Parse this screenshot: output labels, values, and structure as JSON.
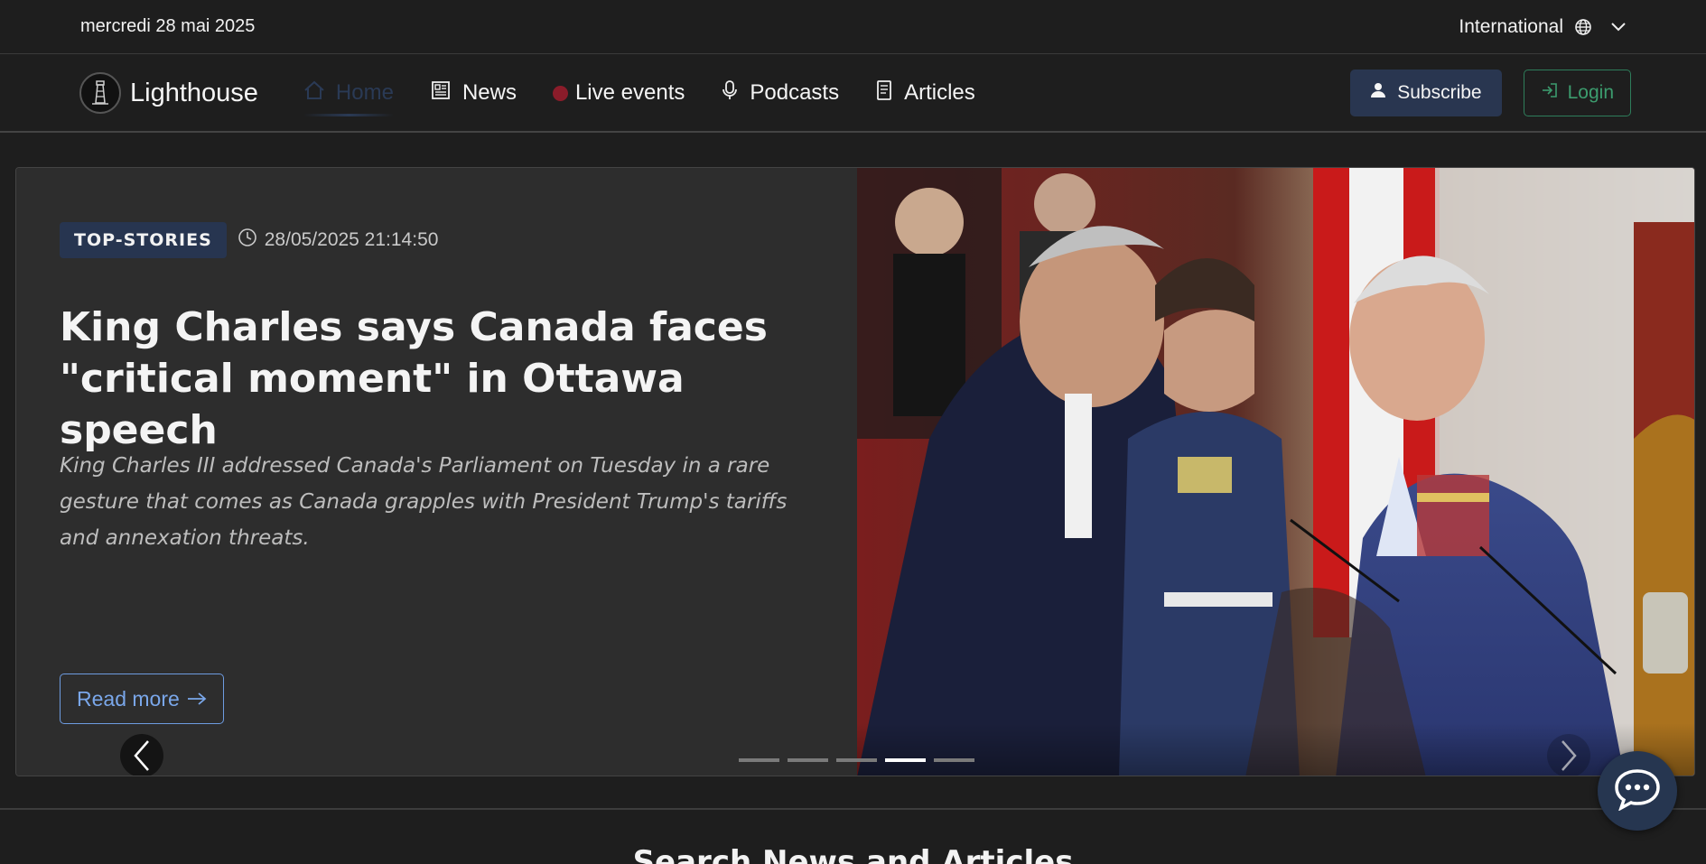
{
  "topbar": {
    "date": "mercredi 28 mai 2025",
    "region": "International"
  },
  "nav": {
    "brand": "Lighthouse",
    "items": [
      {
        "label": "Home",
        "icon": "home-icon",
        "active": true
      },
      {
        "label": "News",
        "icon": "newspaper-icon"
      },
      {
        "label": "Live events",
        "icon": "live-dot"
      },
      {
        "label": "Podcasts",
        "icon": "microphone-icon"
      },
      {
        "label": "Articles",
        "icon": "document-icon"
      }
    ],
    "subscribe_label": "Subscribe",
    "login_label": "Login"
  },
  "hero": {
    "tag": "TOP-STORIES",
    "timestamp": "28/05/2025 21:14:50",
    "headline": "King Charles says Canada faces \"critical moment\" in Ottawa speech",
    "summary": "King Charles III addressed Canada's Parliament on Tuesday in a rare gesture that comes as Canada grapples with President Trump's tariffs and annexation threats.",
    "read_more_label": "Read more",
    "slide_count": 5,
    "active_slide": 4
  },
  "search_section": {
    "title": "Search News and Articles"
  },
  "colors": {
    "accent": "#273550",
    "login": "#3c9c6e",
    "live": "#8b1c2a",
    "link": "#7aa7ea"
  }
}
